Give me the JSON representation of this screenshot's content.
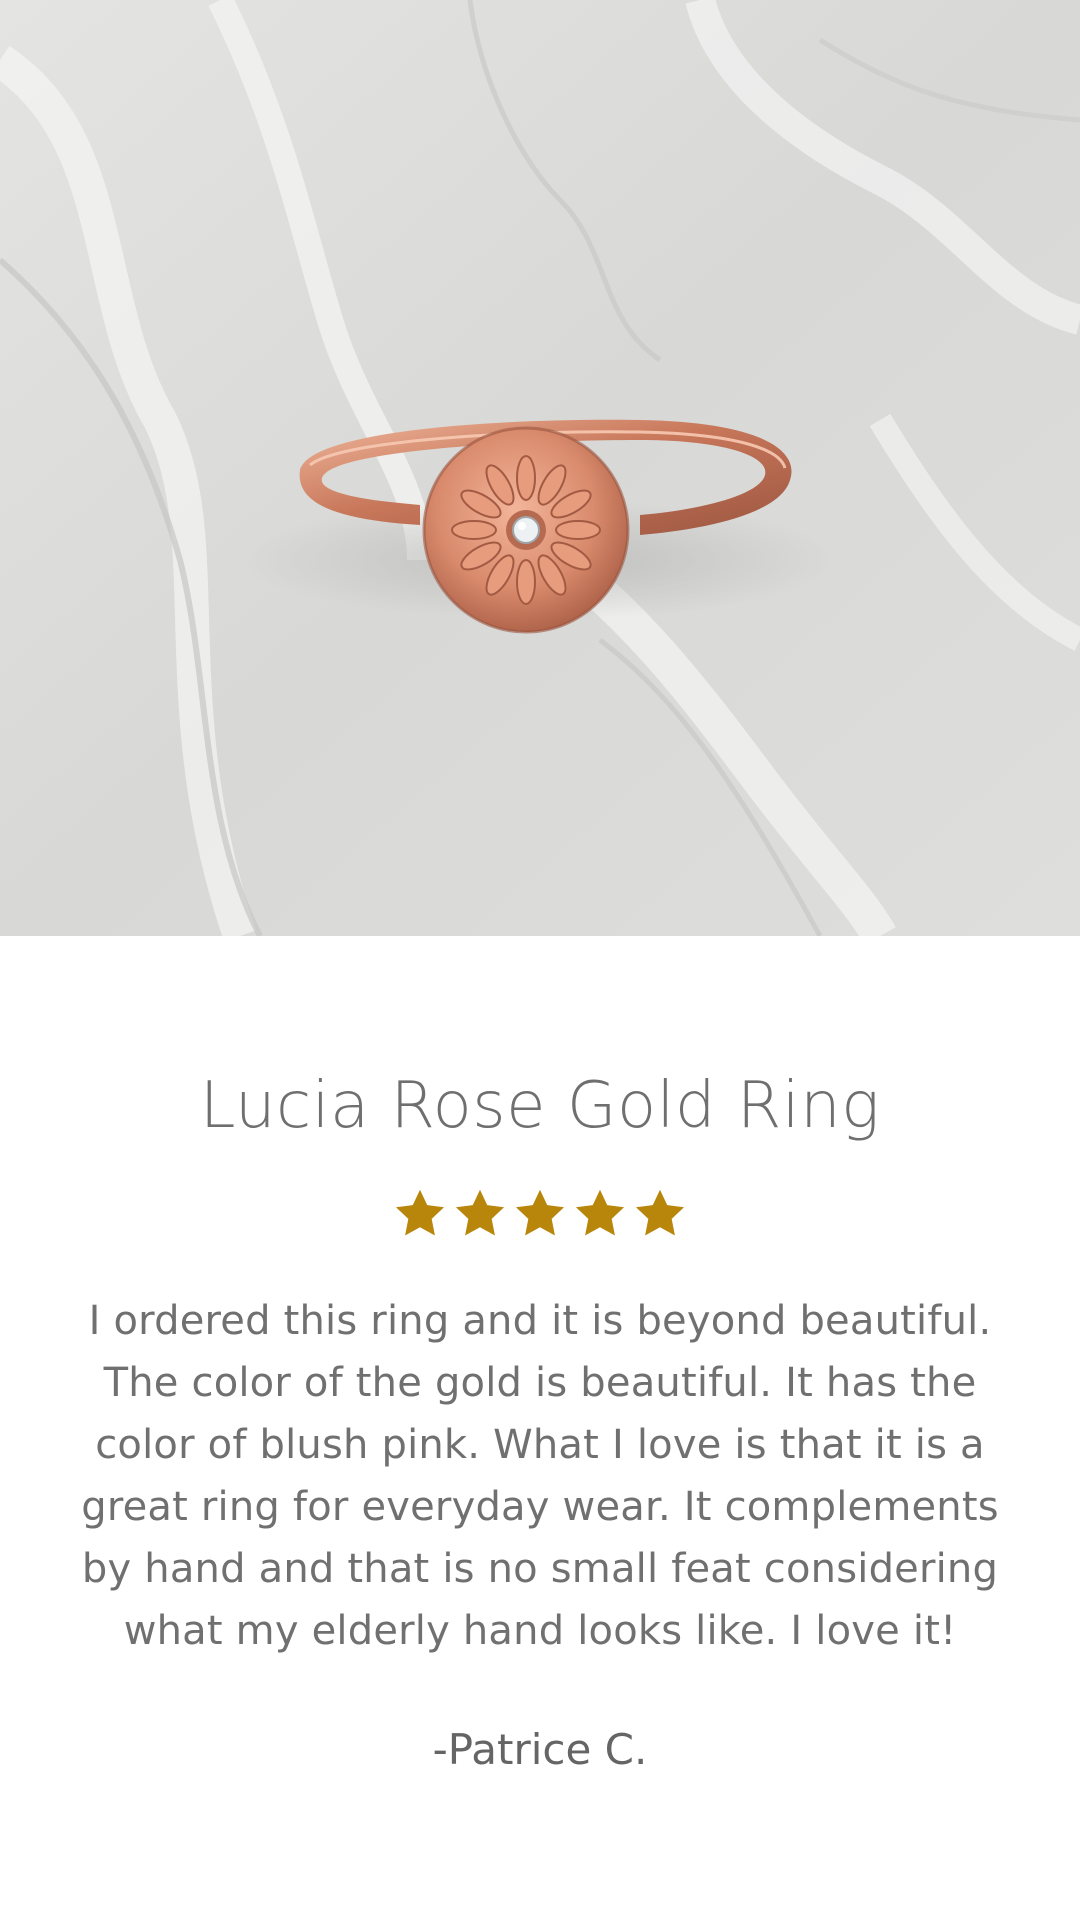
{
  "product": {
    "image_alt": "Rose gold ring with engraved flower disc and small diamond on white plaster surface",
    "title": "Lucia Rose Gold Ring"
  },
  "rating": {
    "value": 5,
    "max": 5,
    "star_color": "#B8860B",
    "icon": "star-icon"
  },
  "review": {
    "text": "I ordered this ring and it is beyond beautiful. The color of the gold is beautiful. It has the color of blush pink. What I love is that it is a great ring for everyday wear. It complements by hand and that is no small feat considering what my elderly hand looks like. I love it!",
    "author": "-Patrice C."
  },
  "colors": {
    "text": "#707070",
    "background": "#ffffff",
    "accent_gold": "#B8860B",
    "rose_gold": "#D9957C"
  }
}
